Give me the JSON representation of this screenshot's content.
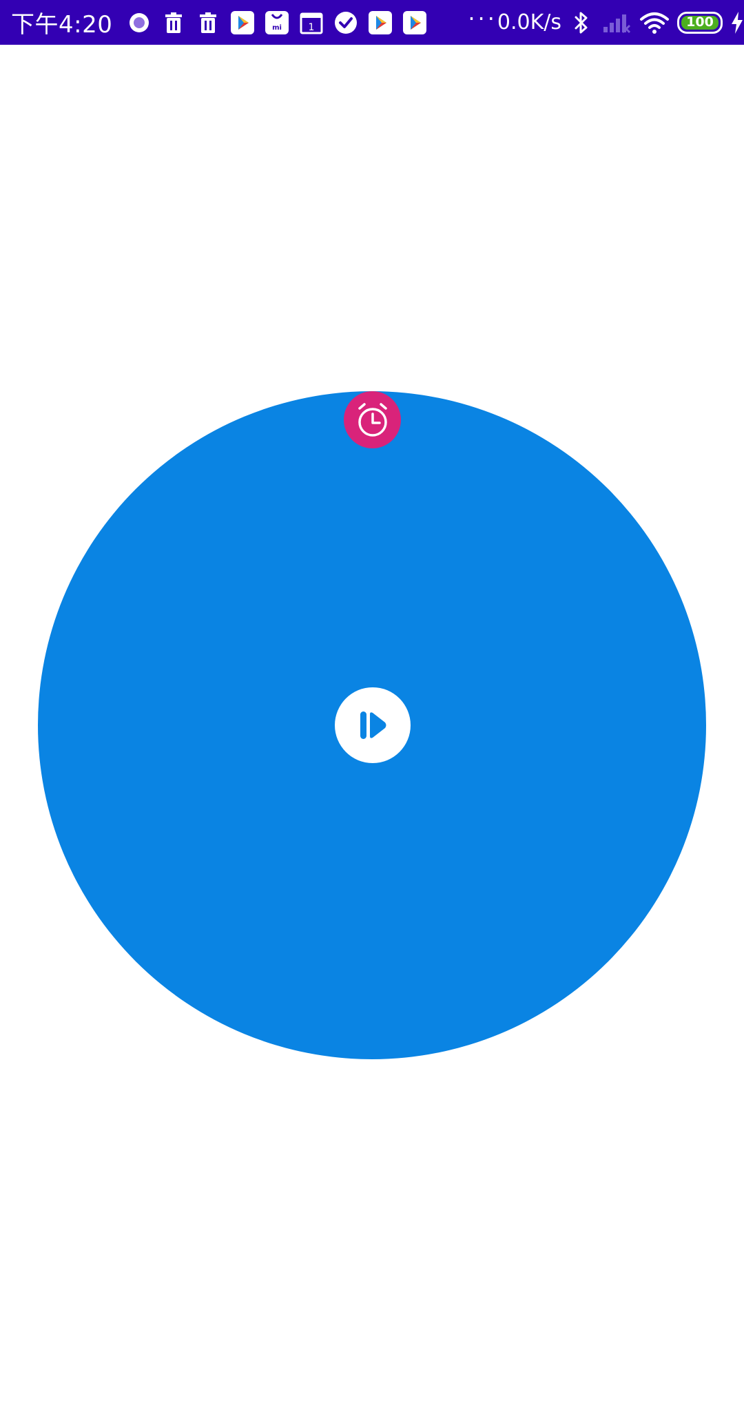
{
  "status_bar": {
    "time": "下午4:20",
    "net_speed": "0.0K/s",
    "battery_level": "100",
    "background_color": "#3300b3",
    "notification_icons": [
      "circle-record-icon",
      "trash-icon",
      "trash-icon",
      "play-store-icon",
      "mi-store-icon",
      "calendar-icon",
      "check-circle-icon",
      "play-store-icon",
      "play-store-icon"
    ],
    "overflow_dots": "···",
    "system_icons": [
      "bluetooth-icon",
      "signal-icon",
      "wifi-icon",
      "battery-icon",
      "charging-icon"
    ],
    "battery_fill_color": "#4caf1f"
  },
  "main": {
    "circle_color": "#0a84e3",
    "play_button_icon": "play-pause-icon",
    "alarm_button_icon": "alarm-clock-icon",
    "alarm_button_color": "#d9237a"
  }
}
